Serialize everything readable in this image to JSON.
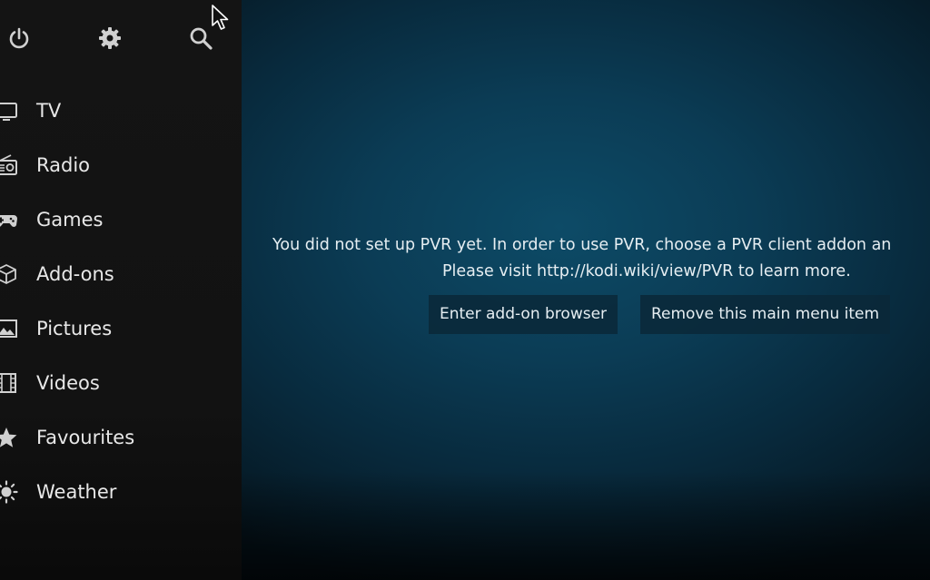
{
  "sidebar": {
    "top_icons": [
      "power-icon",
      "gear-icon",
      "search-icon"
    ],
    "items": [
      {
        "label": "TV",
        "icon": "tv-icon"
      },
      {
        "label": "Radio",
        "icon": "radio-icon"
      },
      {
        "label": "Games",
        "icon": "gamepad-icon"
      },
      {
        "label": "Add-ons",
        "icon": "box-icon"
      },
      {
        "label": "Pictures",
        "icon": "picture-icon"
      },
      {
        "label": "Videos",
        "icon": "film-icon"
      },
      {
        "label": "Favourites",
        "icon": "star-icon"
      },
      {
        "label": "Weather",
        "icon": "sun-icon"
      }
    ]
  },
  "main": {
    "message_line1": "You did not set up PVR yet. In order to use PVR, choose a PVR client addon an",
    "message_line2": "Please visit http://kodi.wiki/view/PVR to learn more.",
    "buttons": {
      "enter_browser": "Enter add-on browser",
      "remove_item": "Remove this main menu item"
    }
  },
  "colors": {
    "sidebar_bg": "#141414",
    "main_bg": "#0b3c55",
    "text": "#e8e8e8"
  }
}
